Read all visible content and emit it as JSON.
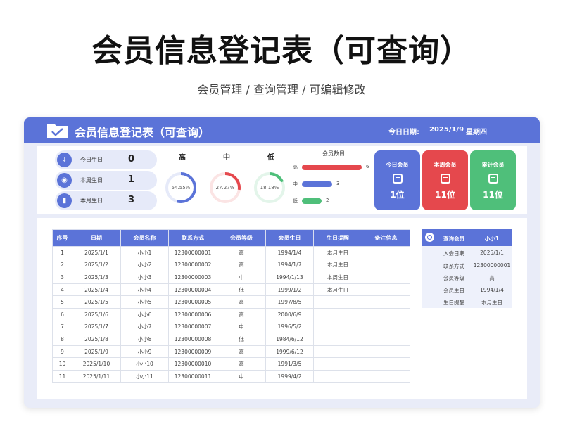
{
  "page": {
    "title": "会员信息登记表（可查询）",
    "subtitle": "会员管理 / 查询管理 / 可编辑修改"
  },
  "header": {
    "title": "会员信息登记表（可查询）",
    "today_label": "今日日期:",
    "today_date": "2025/1/9",
    "today_weekday": "星期四"
  },
  "birthday_stats": [
    {
      "label": "今日生日",
      "value": "0",
      "icon": "download-icon"
    },
    {
      "label": "本周生日",
      "value": "1",
      "icon": "record-icon"
    },
    {
      "label": "本月生日",
      "value": "3",
      "icon": "bar-chart-icon"
    }
  ],
  "levels_donut": [
    {
      "label": "高",
      "percent_text": "54.55%",
      "fraction": 0.5455,
      "color": "#5b73d8"
    },
    {
      "label": "中",
      "percent_text": "27.27%",
      "fraction": 0.2727,
      "color": "#e5484d"
    },
    {
      "label": "低",
      "percent_text": "18.18%",
      "fraction": 0.1818,
      "color": "#4fbf7a"
    }
  ],
  "member_count_chart": {
    "title": "会员数目",
    "bars": [
      {
        "label": "高",
        "value": 6,
        "value_text": "6",
        "color": "#e5484d"
      },
      {
        "label": "中",
        "value": 3,
        "value_text": "3",
        "color": "#5b73d8"
      },
      {
        "label": "低",
        "value": 2,
        "value_text": "2",
        "color": "#4fbf7a"
      }
    ]
  },
  "summary_cards": [
    {
      "title": "今日会员",
      "value": "1位",
      "color": "#5b73d8"
    },
    {
      "title": "本周会员",
      "value": "11位",
      "color": "#e5484d"
    },
    {
      "title": "累计会员",
      "value": "11位",
      "color": "#4fbf7a"
    }
  ],
  "table": {
    "columns": [
      "序号",
      "日期",
      "会员名称",
      "联系方式",
      "会员等级",
      "会员生日",
      "生日提醒",
      "备注信息"
    ],
    "rows": [
      [
        "1",
        "2025/1/1",
        "小小1",
        "12300000001",
        "高",
        "1994/1/4",
        "本月生日",
        ""
      ],
      [
        "2",
        "2025/1/2",
        "小小2",
        "12300000002",
        "高",
        "1994/1/7",
        "本月生日",
        ""
      ],
      [
        "3",
        "2025/1/3",
        "小小3",
        "12300000003",
        "中",
        "1994/1/13",
        "本周生日",
        ""
      ],
      [
        "4",
        "2025/1/4",
        "小小4",
        "12300000004",
        "低",
        "1999/1/2",
        "本月生日",
        ""
      ],
      [
        "5",
        "2025/1/5",
        "小小5",
        "12300000005",
        "高",
        "1997/8/5",
        "",
        ""
      ],
      [
        "6",
        "2025/1/6",
        "小小6",
        "12300000006",
        "高",
        "2000/6/9",
        "",
        ""
      ],
      [
        "7",
        "2025/1/7",
        "小小7",
        "12300000007",
        "中",
        "1996/5/2",
        "",
        ""
      ],
      [
        "8",
        "2025/1/8",
        "小小8",
        "12300000008",
        "低",
        "1984/6/12",
        "",
        ""
      ],
      [
        "9",
        "2025/1/9",
        "小小9",
        "12300000009",
        "高",
        "1999/6/12",
        "",
        ""
      ],
      [
        "10",
        "2025/1/10",
        "小小10",
        "12300000010",
        "高",
        "1991/3/5",
        "",
        ""
      ],
      [
        "11",
        "2025/1/11",
        "小小11",
        "12300000011",
        "中",
        "1999/4/2",
        "",
        ""
      ]
    ]
  },
  "query": {
    "header_label": "查询会员",
    "header_value": "小小1",
    "fields": [
      {
        "label": "入会日期",
        "value": "2025/1/1"
      },
      {
        "label": "联系方式",
        "value": "12300000001"
      },
      {
        "label": "会员等级",
        "value": "高"
      },
      {
        "label": "会员生日",
        "value": "1994/1/4"
      },
      {
        "label": "生日提醒",
        "value": "本月生日"
      }
    ]
  }
}
